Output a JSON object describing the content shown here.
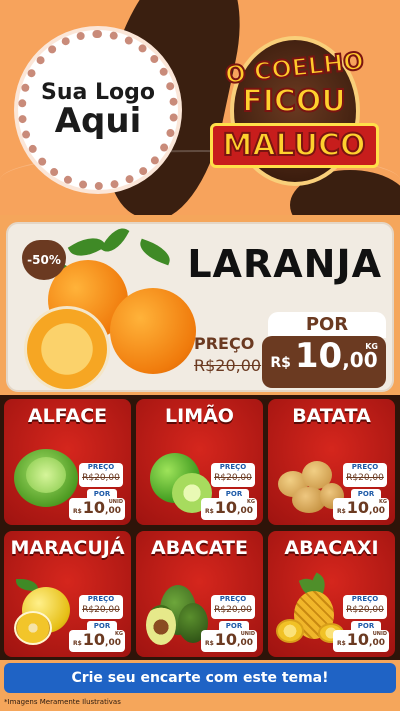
{
  "header": {
    "logo_line1": "Sua Logo",
    "logo_line2": "Aqui",
    "theme_line1": "O Coelho",
    "theme_line2": "Ficou",
    "theme_line3": "Maluco"
  },
  "featured": {
    "discount": "-50%",
    "name": "LARANJA",
    "preco_label": "PREÇO",
    "old_price": "R$20,00",
    "por_label": "POR",
    "new_price_currency": "R$",
    "new_price_int": "10",
    "new_price_dec": ",00",
    "unit": "KG"
  },
  "products": [
    {
      "name": "ALFACE",
      "preco_label": "PREÇO",
      "old_price": "R$20,00",
      "por_label": "POR",
      "currency": "R$",
      "int": "10",
      "dec": ",00",
      "unit": "UNID",
      "icon": "lettuce-icon"
    },
    {
      "name": "LIMÃO",
      "preco_label": "PREÇO",
      "old_price": "R$20,00",
      "por_label": "POR",
      "currency": "R$",
      "int": "10",
      "dec": ",00",
      "unit": "KG",
      "icon": "lime-icon"
    },
    {
      "name": "BATATA",
      "preco_label": "PREÇO",
      "old_price": "R$20,00",
      "por_label": "POR",
      "currency": "R$",
      "int": "10",
      "dec": ",00",
      "unit": "KG",
      "icon": "potato-icon"
    },
    {
      "name": "MARACUJÁ",
      "preco_label": "PREÇO",
      "old_price": "R$20,00",
      "por_label": "POR",
      "currency": "R$",
      "int": "10",
      "dec": ",00",
      "unit": "KG",
      "icon": "passion-fruit-icon"
    },
    {
      "name": "ABACATE",
      "preco_label": "PREÇO",
      "old_price": "R$20,00",
      "por_label": "POR",
      "currency": "R$",
      "int": "10",
      "dec": ",00",
      "unit": "UNID",
      "icon": "avocado-icon"
    },
    {
      "name": "ABACAXI",
      "preco_label": "PREÇO",
      "old_price": "R$20,00",
      "por_label": "POR",
      "currency": "R$",
      "int": "10",
      "dec": ",00",
      "unit": "UNID",
      "icon": "pineapple-icon"
    }
  ],
  "cta": "Crie seu encarte com este tema!",
  "disclaimer": "*Imagens Meramente Ilustrativas",
  "colors": {
    "accent_red": "#c71d1c",
    "brown": "#6b3a21",
    "cta_blue": "#1f63c5",
    "background_orange": "#f7a35c"
  }
}
